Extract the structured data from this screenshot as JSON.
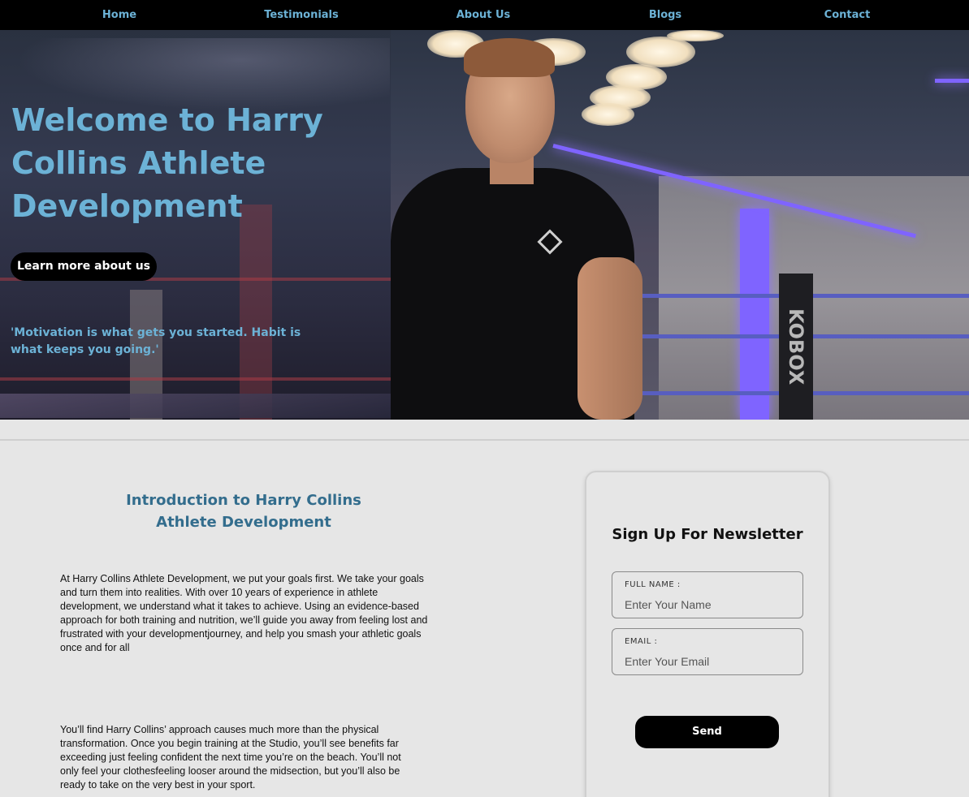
{
  "nav": {
    "items": [
      "Home",
      "Testimonials",
      "About Us",
      "Blogs",
      "Contact"
    ]
  },
  "hero": {
    "title": "Welcome to Harry Collins Athlete Development",
    "button_label": "Learn more about us",
    "quote": "'Motivation is what gets you started. Habit is what keeps you going.'",
    "background_sign": "KOBOX"
  },
  "intro": {
    "title": "Introduction to Harry Collins Athlete Development",
    "paragraph1": "At Harry Collins Athlete Development, we put your goals first. We take your goals and turn them into realities. With over 10 years of experience in athlete development, we understand what it takes to achieve. Using an evidence-based approach for both training and nutrition, we’ll guide you away from feeling lost and frustrated with your developmentjourney, and help you smash your athletic goals once and for all",
    "paragraph2": "You’ll find Harry Collins’ approach causes much more than the physical transformation. Once you begin training at the Studio, you’ll see benefits far exceeding just feeling confident the next time you’re on the beach. You’ll not only feel your clothesfeeling looser around the midsection, but you’ll also be ready to take on the very best in your sport."
  },
  "newsletter": {
    "title": "Sign Up For Newsletter",
    "name_label": "FULL NAME :",
    "name_placeholder": "Enter Your Name",
    "email_label": "EMAIL :",
    "email_placeholder": "Enter Your Email",
    "send_label": "Send"
  },
  "colors": {
    "accent": "#6cb2d6",
    "heading": "#336d8d",
    "nav_bg": "#000000",
    "page_bg": "#e6e6e6"
  }
}
